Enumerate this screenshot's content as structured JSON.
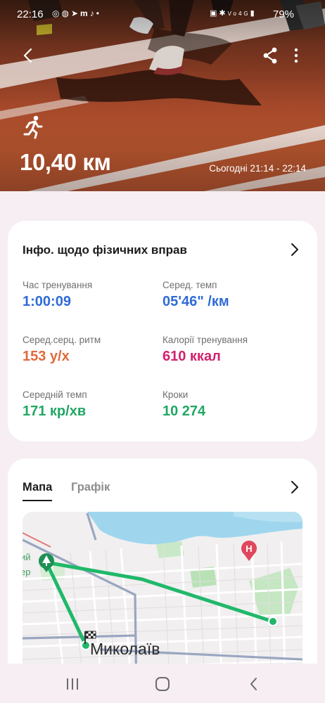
{
  "status_bar": {
    "time": "22:16",
    "left_icons": [
      "instagram-icon",
      "messenger-icon",
      "telegram-icon",
      "m-icon",
      "tiktok-icon",
      "dot-icon"
    ],
    "right_icons": [
      "nfc-icon",
      "bluetooth-icon",
      "volte-icon",
      "signal-4g-icon",
      "signal-bars-icon"
    ],
    "battery": "79%"
  },
  "hero": {
    "distance": "10,40 км",
    "time_range": "Сьогодні 21:14 - 22:14",
    "activity_icon": "running-icon"
  },
  "info_card": {
    "title": "Інфо. щодо фізичних вправ",
    "stats": [
      {
        "label": "Час тренування",
        "value": "1:00:09",
        "color": "#2f6bd6"
      },
      {
        "label": "Серед. темп",
        "value": "05'46\" /км",
        "color": "#2f6bd6"
      },
      {
        "label": "Серед.серц. ритм",
        "value": "153 у/х",
        "color": "#df6a3b"
      },
      {
        "label": "Калорії тренування",
        "value": "610 ккал",
        "color": "#d4206f"
      },
      {
        "label": "Середній темп",
        "value": "171 кр/хв",
        "color": "#22a764"
      },
      {
        "label": "Кроки",
        "value": "10 274",
        "color": "#22a764"
      }
    ]
  },
  "map_card": {
    "tabs": [
      "Мапа",
      "Графік"
    ],
    "active_tab": "Мапа",
    "city_label": "Миколаїв",
    "poi_label_line1": "ий",
    "poi_label_line2": "ер",
    "hospital_marker": "H",
    "route_color": "#20b86a"
  },
  "nav_bar": {
    "buttons": [
      "recent-apps-icon",
      "home-icon",
      "back-icon"
    ]
  }
}
